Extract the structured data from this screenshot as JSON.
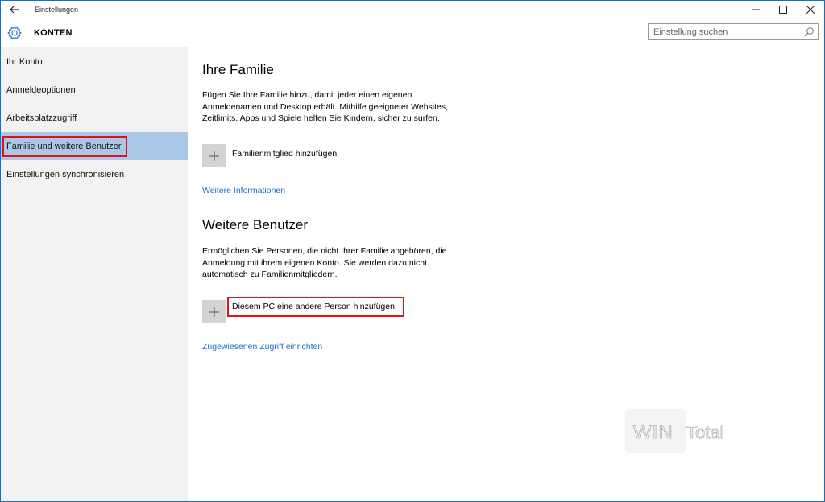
{
  "titlebar": {
    "back_icon": "back-arrow-icon",
    "title": "Einstellungen",
    "minimize_icon": "minimize-icon",
    "maximize_icon": "maximize-icon",
    "close_icon": "close-icon"
  },
  "header": {
    "section_title": "KONTEN",
    "icon": "gear-icon",
    "search_placeholder": "Einstellung suchen",
    "search_value": ""
  },
  "sidebar": {
    "selected_index": 3,
    "items": [
      {
        "label": "Ihr Konto"
      },
      {
        "label": "Anmeldeoptionen"
      },
      {
        "label": "Arbeitsplatzzugriff"
      },
      {
        "label": "Familie und weitere Benutzer"
      },
      {
        "label": "Einstellungen synchronisieren"
      }
    ]
  },
  "family": {
    "heading": "Ihre Familie",
    "description": "Fügen Sie Ihre Familie hinzu, damit jeder einen eigenen Anmeldenamen und Desktop erhält. Mithilfe geeigneter Websites, Zeitlimits, Apps und Spiele helfen Sie Kindern, sicher zu surfen.",
    "add_label": "Familienmitglied hinzufügen",
    "link": "Weitere Informationen"
  },
  "others": {
    "heading": "Weitere Benutzer",
    "description": "Ermöglichen Sie Personen, die nicht Ihrer Familie angehören, die Anmeldung mit ihrem eigenen Konto. Sie werden dazu nicht automatisch zu Familienmitgliedern.",
    "add_label": "Diesem PC eine andere Person hinzufügen",
    "link": "Zugewiesenen Zugriff einrichten"
  },
  "watermark": {
    "text": "WIN Total"
  },
  "colors": {
    "accent": "#1f6fc4",
    "selection": "#aac8e6",
    "highlight": "#e0111b",
    "sidebar_bg": "#f2f2f2",
    "tile": "#d3d3d3"
  }
}
